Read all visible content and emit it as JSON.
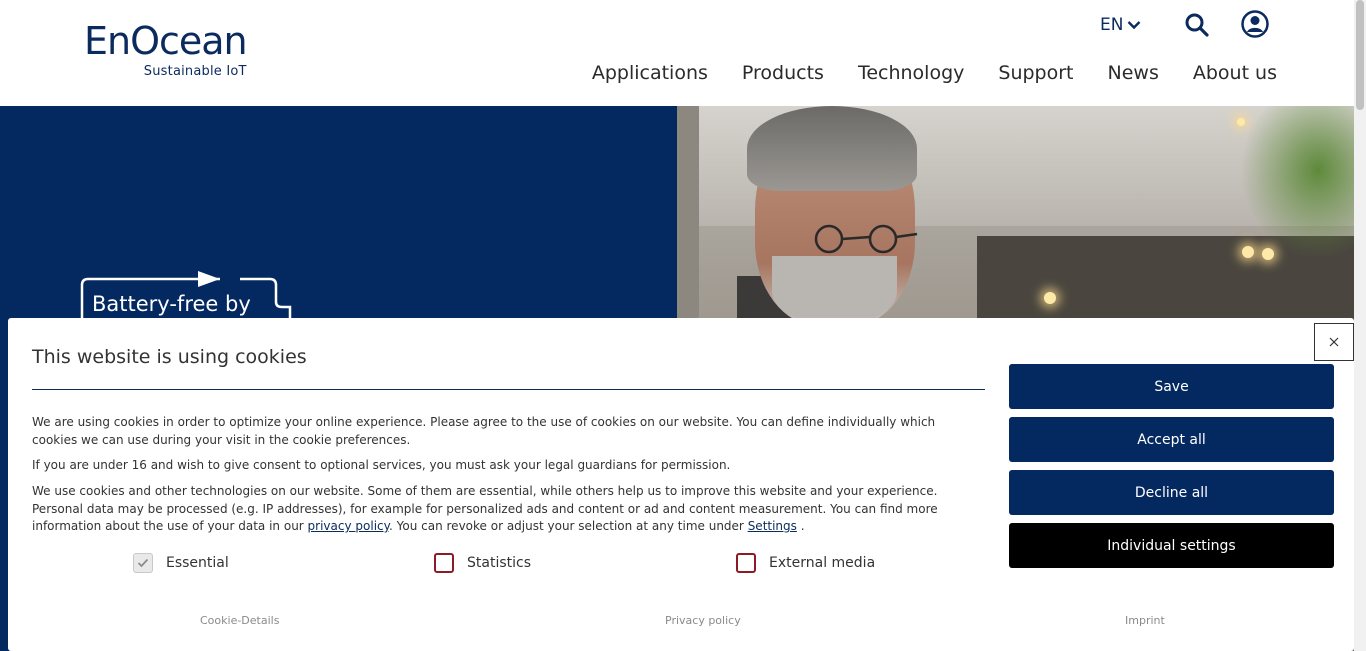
{
  "header": {
    "logo_main": "EnOcean",
    "logo_sub": "Sustainable IoT",
    "language": "EN",
    "nav": [
      "Applications",
      "Products",
      "Technology",
      "Support",
      "News",
      "About us"
    ]
  },
  "hero": {
    "badge_text": "Battery-free by"
  },
  "cookie": {
    "title": "This website is using cookies",
    "p1": "We are using cookies in order to optimize your online experience. Please agree to the use of cookies on our website. You can define individually which cookies we can use during your visit in the cookie preferences.",
    "p2": "If you are under 16 and wish to give consent to optional services, you must ask your legal guardians for permission.",
    "p3_a": "We use cookies and other technologies on our website. Some of them are essential, while others help us to improve this website and your experience. Personal data may be processed (e.g. IP addresses), for example for personalized ads and content or ad and content measurement. You can find more information about the use of your data in our ",
    "p3_link1": "privacy policy",
    "p3_b": ". You can revoke or adjust your selection at any time under ",
    "p3_link2": "Settings",
    "p3_c": " .",
    "checks": [
      {
        "label": "Essential",
        "checked": true,
        "disabled": true
      },
      {
        "label": "Statistics",
        "checked": false,
        "disabled": false
      },
      {
        "label": "External media",
        "checked": false,
        "disabled": false
      }
    ],
    "footer_links": [
      "Cookie-Details",
      "Privacy policy",
      "Imprint"
    ],
    "buttons": {
      "save": "Save",
      "accept": "Accept all",
      "decline": "Decline all",
      "individual": "Individual settings"
    }
  },
  "colors": {
    "brand_navy": "#042860",
    "checkbox_border": "#8b1c25"
  }
}
